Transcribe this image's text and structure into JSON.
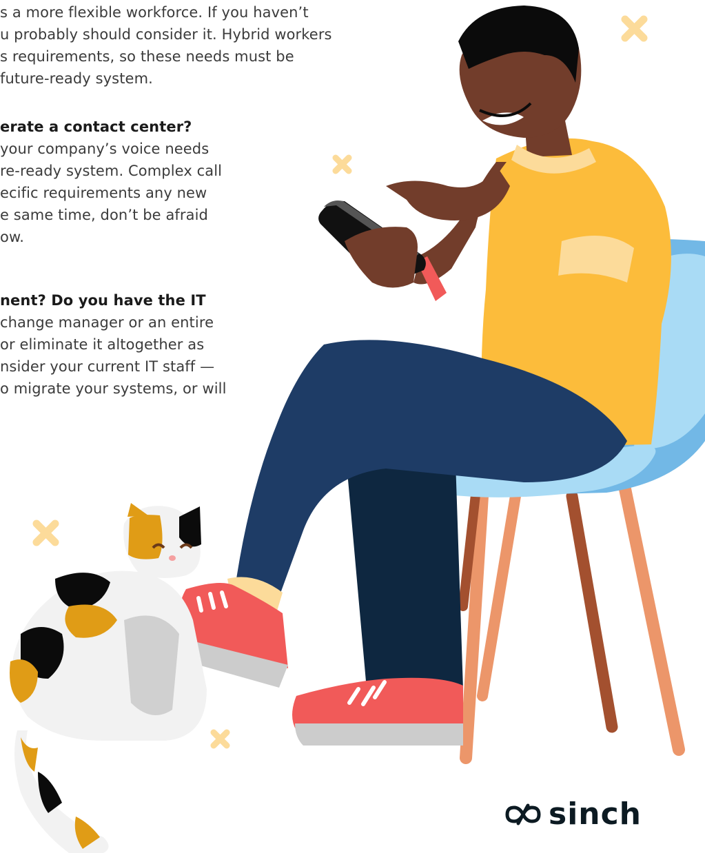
{
  "paragraphs": [
    {
      "lines": [
        "s a more flexible workforce. If you haven’t",
        "u probably should consider it. Hybrid workers",
        "s requirements, so these needs must be",
        " future-ready system."
      ]
    },
    {
      "heading": "erate a contact center?",
      "lines": [
        "your company’s voice needs",
        "re-ready system. Complex call",
        "ecific requirements any new",
        "e same time, don’t be afraid",
        "ow."
      ]
    },
    {
      "heading": "nent? Do you have the IT",
      "lines": [
        "change manager or an entire",
        "or eliminate it altogether as",
        "nsider your current IT staff —",
        "o migrate your systems, or will"
      ]
    }
  ],
  "logo": {
    "text": "sinch"
  },
  "colors": {
    "text": "#3b3b3b",
    "heading": "#1a1a1a",
    "shirt": "#fcbc3b",
    "skin": "#723d2b",
    "pants": "#1e3c66",
    "shoe": "#f15a59",
    "chair_seat": "#a9dbf5",
    "chair_leg_dark": "#a3502f",
    "chair_leg_light": "#ec966a",
    "accent_x": "#fcdb9a",
    "cat_orange": "#e09c16",
    "cat_black": "#0b0b0b",
    "logo": "#0c1a22"
  }
}
